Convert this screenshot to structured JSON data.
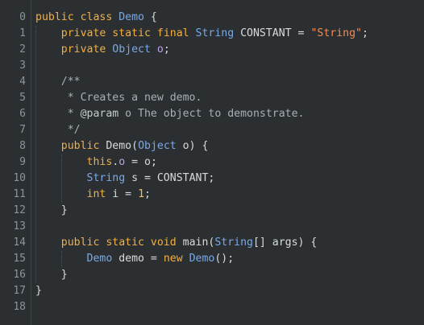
{
  "editor": {
    "line_numbers": [
      "0",
      "1",
      "2",
      "3",
      "4",
      "5",
      "6",
      "7",
      "8",
      "9",
      "10",
      "11",
      "12",
      "13",
      "14",
      "15",
      "16",
      "17",
      "18"
    ],
    "lines": [
      [
        {
          "t": "public ",
          "c": "kw"
        },
        {
          "t": "class ",
          "c": "kw"
        },
        {
          "t": "Demo",
          "c": "ty"
        },
        {
          "t": " {",
          "c": ""
        }
      ],
      [
        {
          "t": "    ",
          "c": ""
        },
        {
          "t": "private ",
          "c": "kw"
        },
        {
          "t": "static ",
          "c": "kw"
        },
        {
          "t": "final ",
          "c": "kw"
        },
        {
          "t": "String",
          "c": "ty"
        },
        {
          "t": " CONSTANT = ",
          "c": ""
        },
        {
          "t": "\"String\"",
          "c": "str"
        },
        {
          "t": ";",
          "c": ""
        }
      ],
      [
        {
          "t": "    ",
          "c": ""
        },
        {
          "t": "private ",
          "c": "kw"
        },
        {
          "t": "Object",
          "c": "ty"
        },
        {
          "t": " ",
          "c": ""
        },
        {
          "t": "o",
          "c": "fld"
        },
        {
          "t": ";",
          "c": ""
        }
      ],
      [],
      [
        {
          "t": "    ",
          "c": ""
        },
        {
          "t": "/**",
          "c": "com"
        }
      ],
      [
        {
          "t": "     ",
          "c": ""
        },
        {
          "t": "* Creates a new demo.",
          "c": "com"
        }
      ],
      [
        {
          "t": "     ",
          "c": ""
        },
        {
          "t": "* ",
          "c": "com"
        },
        {
          "t": "@param",
          "c": "dim"
        },
        {
          "t": " o The object to demonstrate.",
          "c": "com"
        }
      ],
      [
        {
          "t": "     ",
          "c": ""
        },
        {
          "t": "*/",
          "c": "com"
        }
      ],
      [
        {
          "t": "    ",
          "c": ""
        },
        {
          "t": "public ",
          "c": "kw"
        },
        {
          "t": "Demo",
          "c": ""
        },
        {
          "t": "(",
          "c": ""
        },
        {
          "t": "Object",
          "c": "ty"
        },
        {
          "t": " o) {",
          "c": ""
        }
      ],
      [
        {
          "t": "        ",
          "c": ""
        },
        {
          "t": "this",
          "c": "kw"
        },
        {
          "t": ".",
          "c": ""
        },
        {
          "t": "o",
          "c": "fld"
        },
        {
          "t": " = o;",
          "c": ""
        }
      ],
      [
        {
          "t": "        ",
          "c": ""
        },
        {
          "t": "String",
          "c": "ty"
        },
        {
          "t": " s = CONSTANT;",
          "c": ""
        }
      ],
      [
        {
          "t": "        ",
          "c": ""
        },
        {
          "t": "int",
          "c": "kw"
        },
        {
          "t": " i = ",
          "c": ""
        },
        {
          "t": "1",
          "c": "num"
        },
        {
          "t": ";",
          "c": ""
        }
      ],
      [
        {
          "t": "    }",
          "c": ""
        }
      ],
      [],
      [
        {
          "t": "    ",
          "c": ""
        },
        {
          "t": "public ",
          "c": "kw"
        },
        {
          "t": "static ",
          "c": "kw"
        },
        {
          "t": "void ",
          "c": "kw"
        },
        {
          "t": "main(",
          "c": ""
        },
        {
          "t": "String",
          "c": "ty"
        },
        {
          "t": "[] args) {",
          "c": ""
        }
      ],
      [
        {
          "t": "        ",
          "c": ""
        },
        {
          "t": "Demo",
          "c": "ty"
        },
        {
          "t": " demo = ",
          "c": ""
        },
        {
          "t": "new ",
          "c": "kw"
        },
        {
          "t": "Demo",
          "c": "ty"
        },
        {
          "t": "();",
          "c": ""
        }
      ],
      [
        {
          "t": "    }",
          "c": ""
        }
      ],
      [
        {
          "t": "}",
          "c": ""
        }
      ],
      []
    ],
    "colors": {
      "background": "#2b2f31",
      "keyword": "#f2b043",
      "type": "#7aa9e6",
      "string": "#f38c52",
      "comment": "#a7b0b3"
    }
  }
}
